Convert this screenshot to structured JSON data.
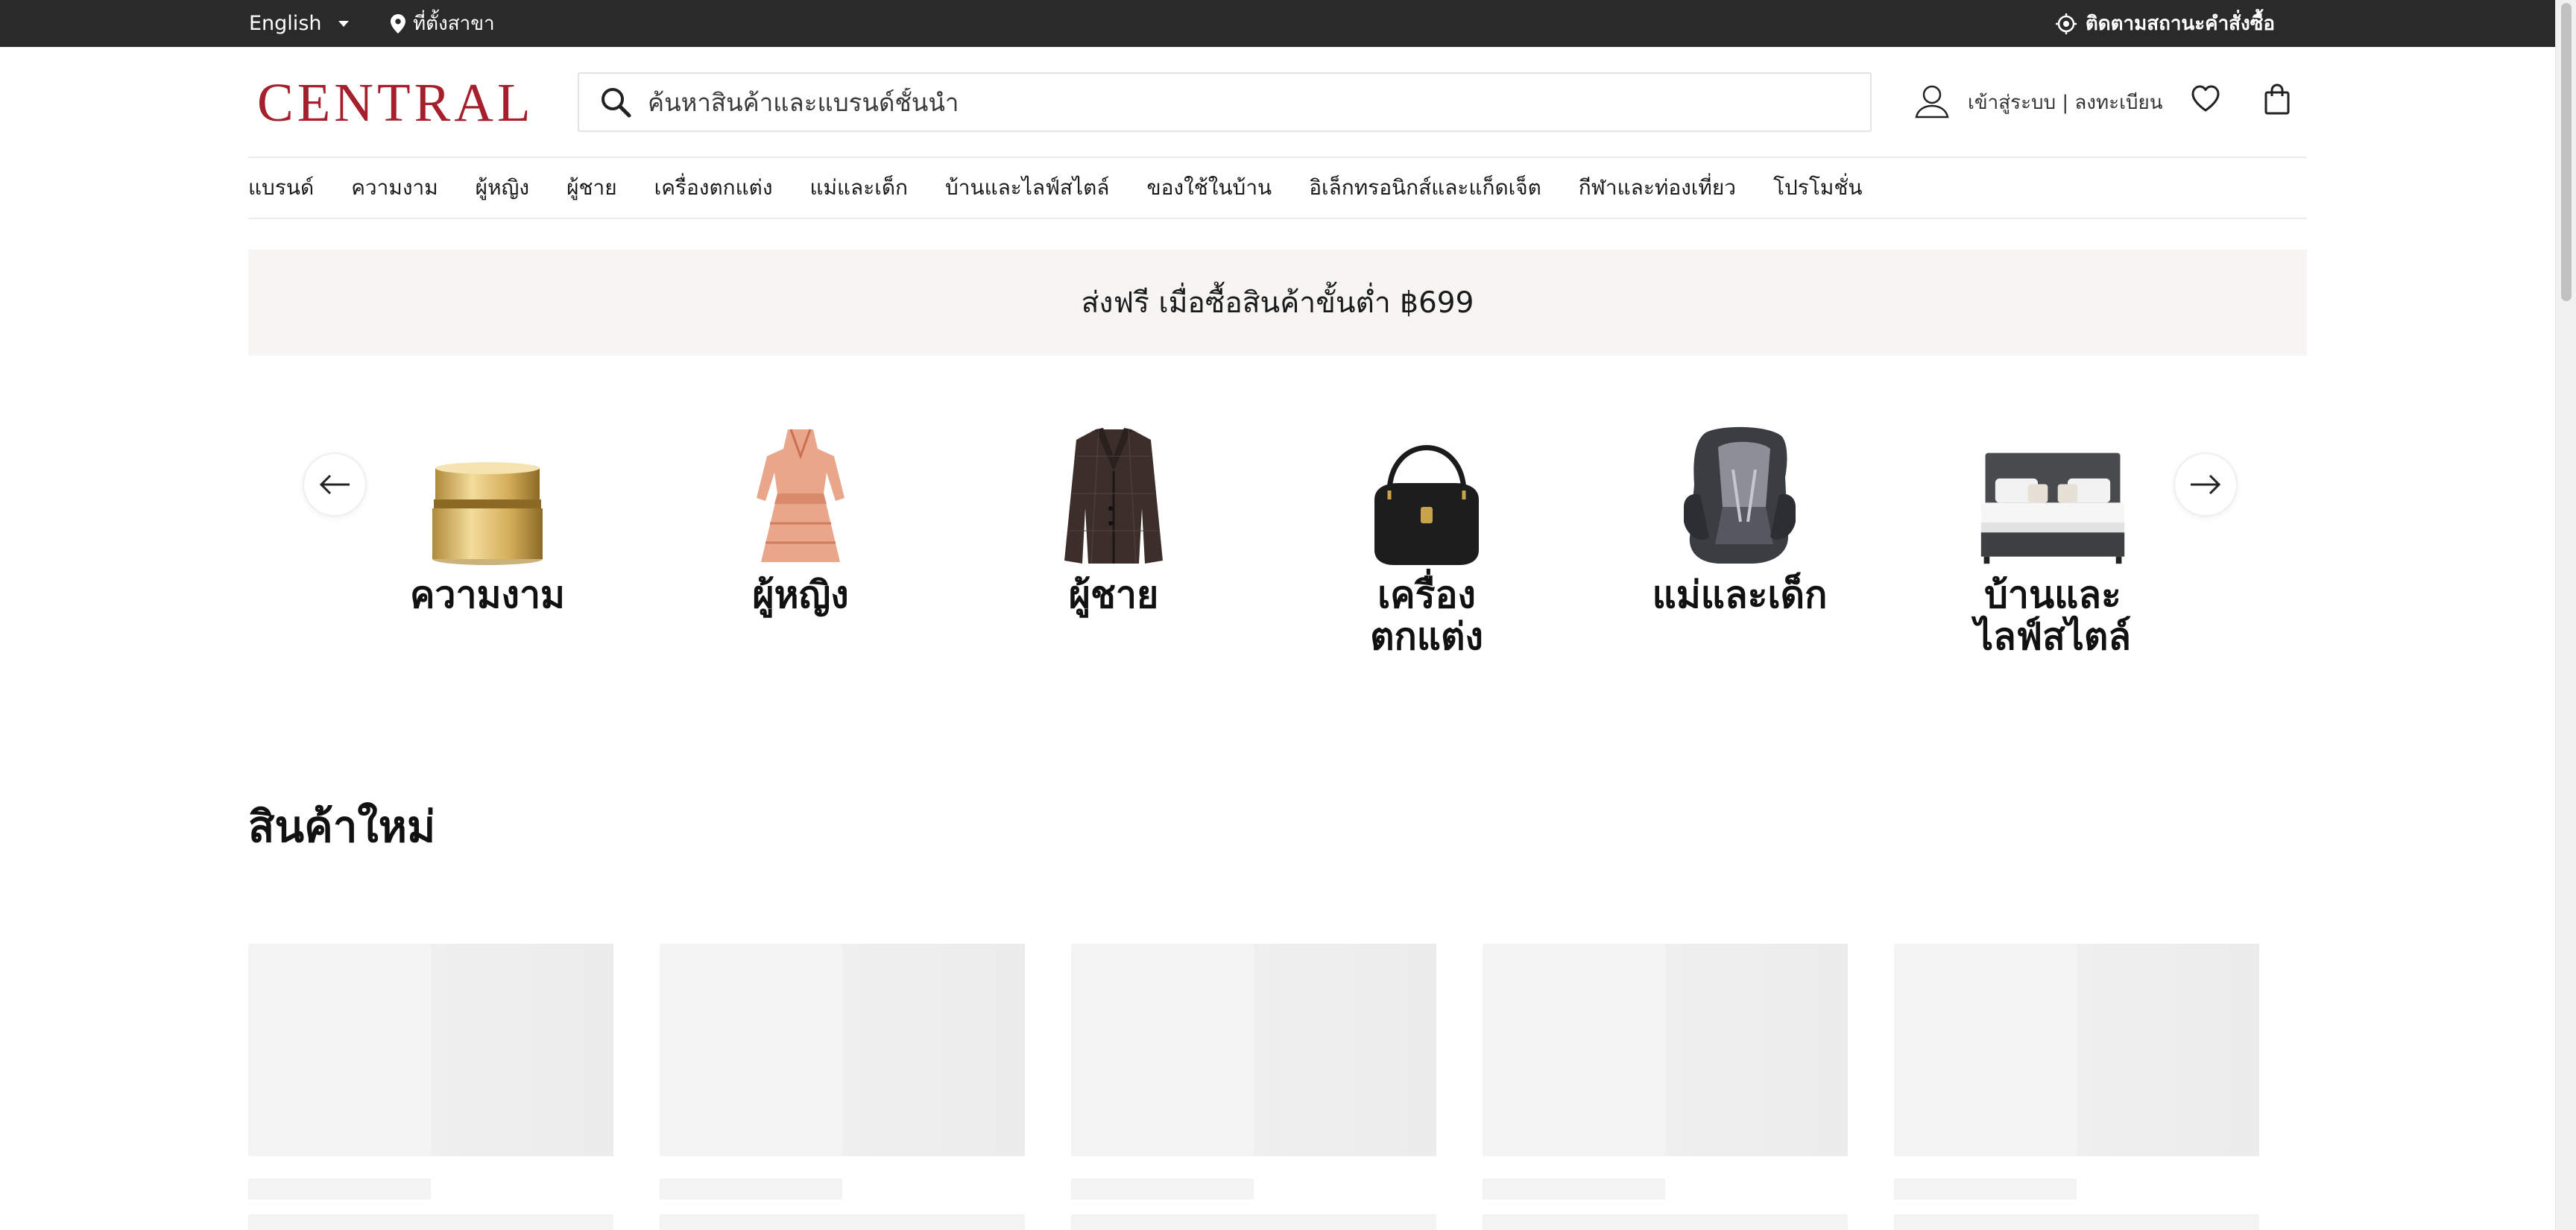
{
  "topbar": {
    "language": "English",
    "store_locator": "ที่ตั้งสาขา",
    "track_order": "ติดตามสถานะคำสั่งซื้อ"
  },
  "header": {
    "logo": "CENTRAL",
    "search_placeholder": "ค้นหาสินค้าและแบรนด์ชั้นนำ",
    "account_label": "เข้าสู่ระบบ | ลงทะเบียน"
  },
  "nav": [
    "แบรนด์",
    "ความงาม",
    "ผู้หญิง",
    "ผู้ชาย",
    "เครื่องตกแต่ง",
    "แม่และเด็ก",
    "บ้านและไลฟ์สไตล์",
    "ของใช้ในบ้าน",
    "อิเล็กทรอนิกส์และแก็ดเจ็ต",
    "กีฬาและท่องเที่ยว",
    "โปรโมชั่น"
  ],
  "promo": "ส่งฟรี เมื่อซื้อสินค้าขั้นต่ำ ฿699",
  "categories": [
    {
      "line1": "ความงาม",
      "line2": "",
      "icon": "beauty-cream-jar-icon"
    },
    {
      "line1": "ผู้หญิง",
      "line2": "",
      "icon": "women-dress-icon"
    },
    {
      "line1": "ผู้ชาย",
      "line2": "",
      "icon": "men-blazer-icon"
    },
    {
      "line1": "เครื่อง",
      "line2": "ตกแต่ง",
      "icon": "handbag-icon"
    },
    {
      "line1": "แม่และเด็ก",
      "line2": "",
      "icon": "car-seat-icon"
    },
    {
      "line1": "บ้านและ",
      "line2": "ไลฟ์สไตล์",
      "icon": "bed-icon"
    }
  ],
  "new_products_title": "สินค้าใหม่",
  "colors": {
    "topbar_bg": "#2a2a2a",
    "brand_red": "#a51f2c",
    "promo_bg": "#f6f5f4"
  }
}
